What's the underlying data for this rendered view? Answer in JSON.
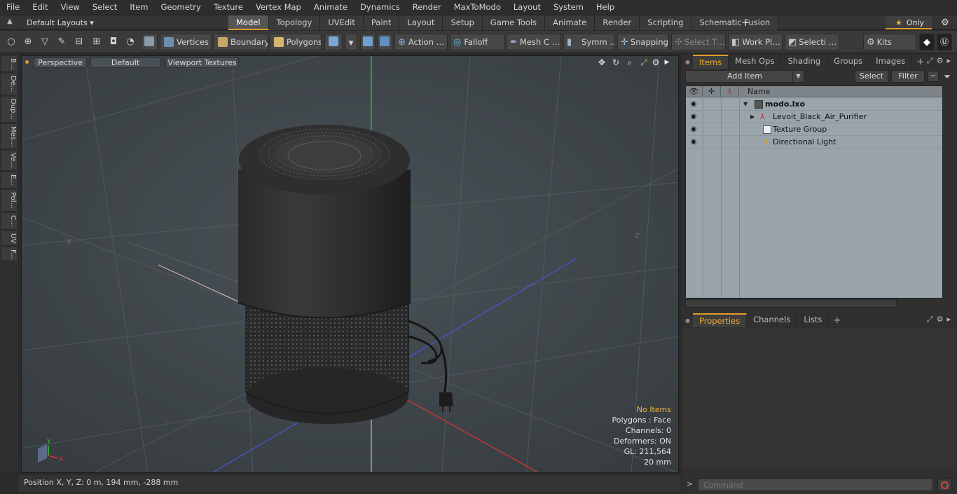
{
  "menu": [
    "File",
    "Edit",
    "View",
    "Select",
    "Item",
    "Geometry",
    "Texture",
    "Vertex Map",
    "Animate",
    "Dynamics",
    "Render",
    "MaxToModo",
    "Layout",
    "System",
    "Help"
  ],
  "layoutbar": {
    "layout_select": "Default Layouts ▾",
    "tabs": [
      "Model",
      "Topology",
      "UVEdit",
      "Paint",
      "Layout",
      "Setup",
      "Game Tools",
      "Animate",
      "Render",
      "Scripting",
      "Schematic Fusion"
    ],
    "active_tab": "Model",
    "plus": "+",
    "only_label": "Only",
    "accent": "#e09b2a"
  },
  "toolbar": {
    "vertices": "Vertices",
    "boundary": "Boundary",
    "polygons": "Polygons",
    "action": "Action …",
    "falloff": "Falloff",
    "mesh": "Mesh C …",
    "symm": "Symm …",
    "snapping": "Snapping",
    "select_t": "Select T…",
    "work_pl": "Work Pl…",
    "selecti": "Selecti …",
    "kits": "Kits"
  },
  "left_tabs": [
    "B...",
    "De...",
    "Dup...",
    "Mes...",
    "Ve...",
    "E...",
    "Pol...",
    "C...",
    "UV",
    "F..."
  ],
  "viewport": {
    "perspective": "Perspective",
    "default": "Default",
    "viewport_textures": "Viewport Textures",
    "axis_x_label": "X",
    "axis_z_label": "Z",
    "info": {
      "no_items": "No Items",
      "polygons": "Polygons : Face",
      "channels": "Channels: 0",
      "deformers": "Deformers: ON",
      "gl": "GL: 211,564",
      "scale": "20 mm"
    },
    "gizmo_y": "Y",
    "gizmo_x": "X"
  },
  "status": {
    "position": "Position X, Y, Z:   0 m, 194 mm, -288 mm"
  },
  "items_panel": {
    "tabs": [
      "Items",
      "Mesh Ops",
      "Shading",
      "Groups",
      "Images"
    ],
    "active_tab": "Items",
    "plus": "+",
    "add_item": "Add Item",
    "select": "Select",
    "filter": "Filter",
    "header_name": "Name",
    "rows": [
      {
        "label": "modo.lxo",
        "bold": true
      },
      {
        "label": "Levoit_Black_Air_Purifier",
        "bold": false
      },
      {
        "label": "Texture Group",
        "bold": false
      },
      {
        "label": "Directional Light",
        "bold": false
      }
    ]
  },
  "properties_panel": {
    "tabs": [
      "Properties",
      "Channels",
      "Lists"
    ],
    "active_tab": "Properties",
    "plus": "+"
  },
  "command": {
    "placeholder": "Command"
  }
}
